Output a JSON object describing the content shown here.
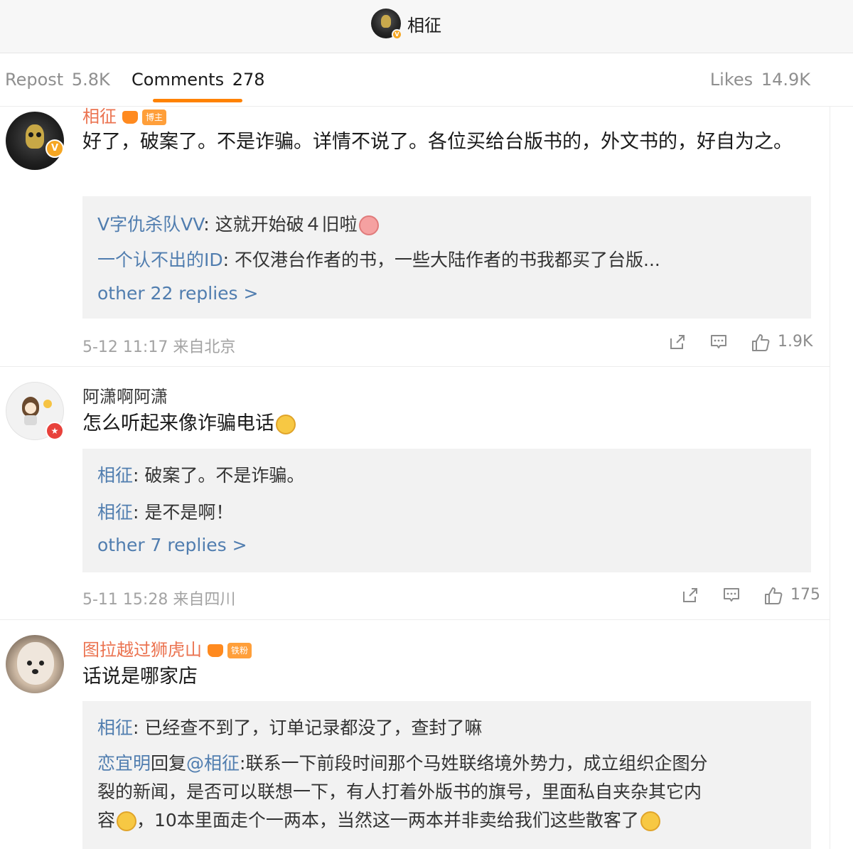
{
  "header": {
    "title": "相征"
  },
  "tabs": {
    "repost_label": "Repost",
    "repost_count": "5.8K",
    "comments_label": "Comments",
    "comments_count": "278",
    "likes_label": "Likes",
    "likes_count": "14.9K"
  },
  "comments": [
    {
      "user": "相征",
      "tag": "博主",
      "text": "好了，破案了。不是诈骗。详情不说了。各位买给台版书的，外文书的，好自为之。",
      "replies": [
        {
          "name": "V字仇杀队VV",
          "text": ": 这就开始破４旧啦",
          "emoji": "pig-emoji"
        },
        {
          "name": "一个认不出的ID",
          "text": ": 不仅港台作者的书，一些大陆作者的书我都买了台版..."
        }
      ],
      "more": "other 22 replies >",
      "time": "5-12 11:17",
      "location": "来自北京",
      "likes": "1.9K"
    },
    {
      "user": "阿潇啊阿潇",
      "text": "怎么听起来像诈骗电话",
      "replies": [
        {
          "name": "相征",
          "text": ": 破案了。不是诈骗。"
        },
        {
          "name": "相征",
          "text": ": 是不是啊！"
        }
      ],
      "more": "other 7 replies >",
      "time": "5-11 15:28",
      "location": "来自四川",
      "likes": "175"
    },
    {
      "user": "图拉越过狮虎山",
      "tag": "铁粉",
      "text": "话说是哪家店",
      "replies": [
        {
          "name": "相征",
          "text": ": 已经查不到了，订单记录都没了，查封了嘛"
        },
        {
          "name": "恋宜明",
          "mid": "回复",
          "at": "@相征",
          "text": ":联系一下前段时间那个马姓联络境外势力，成立组织企图分",
          "line2": "裂的新闻，是否可以联想一下，有人打着外版书的旗号，里面私自夹杂其它内",
          "line3a": "容",
          "line3b": "，10本里面走个一两本，当然这一两本并非卖给我们这些散客了"
        }
      ]
    }
  ]
}
